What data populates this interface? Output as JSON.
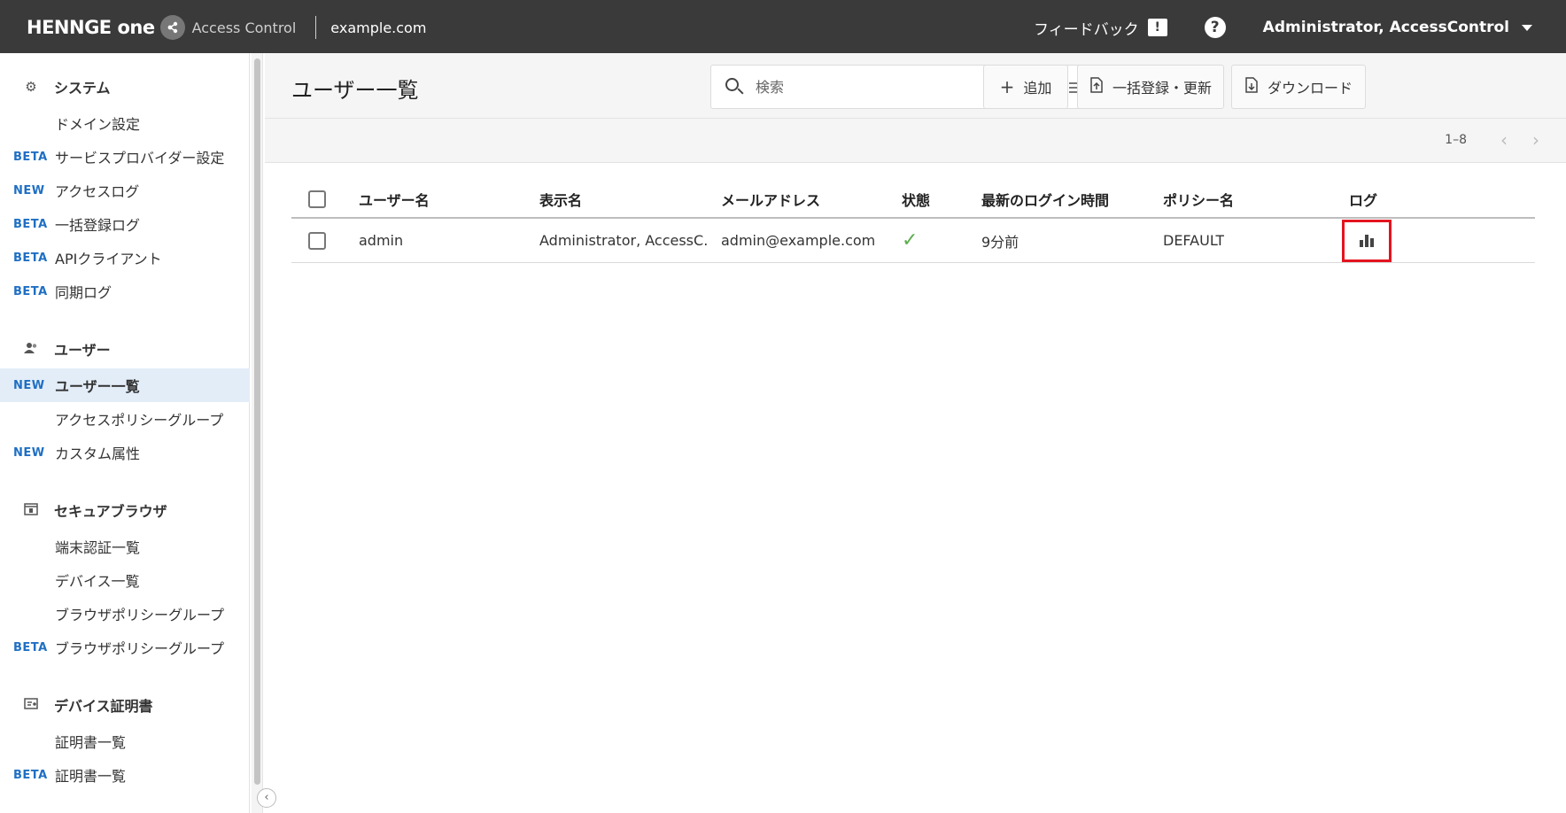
{
  "topbar": {
    "brand": "HENNGE one",
    "product": "Access Control",
    "domain": "example.com",
    "feedback_label": "フィードバック",
    "feedback_icon": "!",
    "help_icon": "?",
    "user_name": "Administrator, AccessControl"
  },
  "sidebar": {
    "sections": {
      "system": {
        "title": "システム",
        "icon": "gear-icon",
        "items": [
          {
            "badge": "",
            "label": "ドメイン設定"
          },
          {
            "badge": "BETA",
            "label": "サービスプロバイダー設定"
          },
          {
            "badge": "NEW",
            "label": "アクセスログ"
          },
          {
            "badge": "BETA",
            "label": "一括登録ログ"
          },
          {
            "badge": "BETA",
            "label": "APIクライアント"
          },
          {
            "badge": "BETA",
            "label": "同期ログ"
          }
        ]
      },
      "users": {
        "title": "ユーザー",
        "icon": "users-icon",
        "items": [
          {
            "badge": "NEW",
            "label": "ユーザー一覧",
            "active": true
          },
          {
            "badge": "",
            "label": "アクセスポリシーグループ"
          },
          {
            "badge": "NEW",
            "label": "カスタム属性"
          }
        ]
      },
      "secure_browser": {
        "title": "セキュアブラウザ",
        "icon": "browser-icon",
        "items": [
          {
            "badge": "",
            "label": "端末認証一覧"
          },
          {
            "badge": "",
            "label": "デバイス一覧"
          },
          {
            "badge": "",
            "label": "ブラウザポリシーグループ"
          },
          {
            "badge": "BETA",
            "label": "ブラウザポリシーグループ"
          }
        ]
      },
      "device_cert": {
        "title": "デバイス証明書",
        "icon": "certificate-icon",
        "items": [
          {
            "badge": "",
            "label": "証明書一覧"
          },
          {
            "badge": "BETA",
            "label": "証明書一覧"
          }
        ]
      }
    }
  },
  "main": {
    "title": "ユーザー一覧",
    "search": {
      "placeholder": "検索"
    },
    "buttons": {
      "add": "追加",
      "bulk": "一括登録・更新",
      "download": "ダウンロード"
    },
    "pager": {
      "range": "1–8",
      "prev": "‹",
      "next": "›"
    },
    "table": {
      "headers": {
        "username": "ユーザー名",
        "display_name": "表示名",
        "email": "メールアドレス",
        "status": "状態",
        "last_login": "最新のログイン時間",
        "policy": "ポリシー名",
        "log": "ログ"
      },
      "rows": [
        {
          "username": "admin",
          "display_name": "Administrator, AccessC...",
          "email": "admin@example.com",
          "status": "✓",
          "last_login": "9分前",
          "policy": "DEFAULT",
          "log_icon": "bar-chart-icon"
        }
      ]
    }
  },
  "colors": {
    "topbar": "#3a3a3a",
    "badge": "#1f6fc4",
    "active_item": "#e3edf8",
    "status_ok": "#5cae4e",
    "highlight": "#e3141f"
  }
}
